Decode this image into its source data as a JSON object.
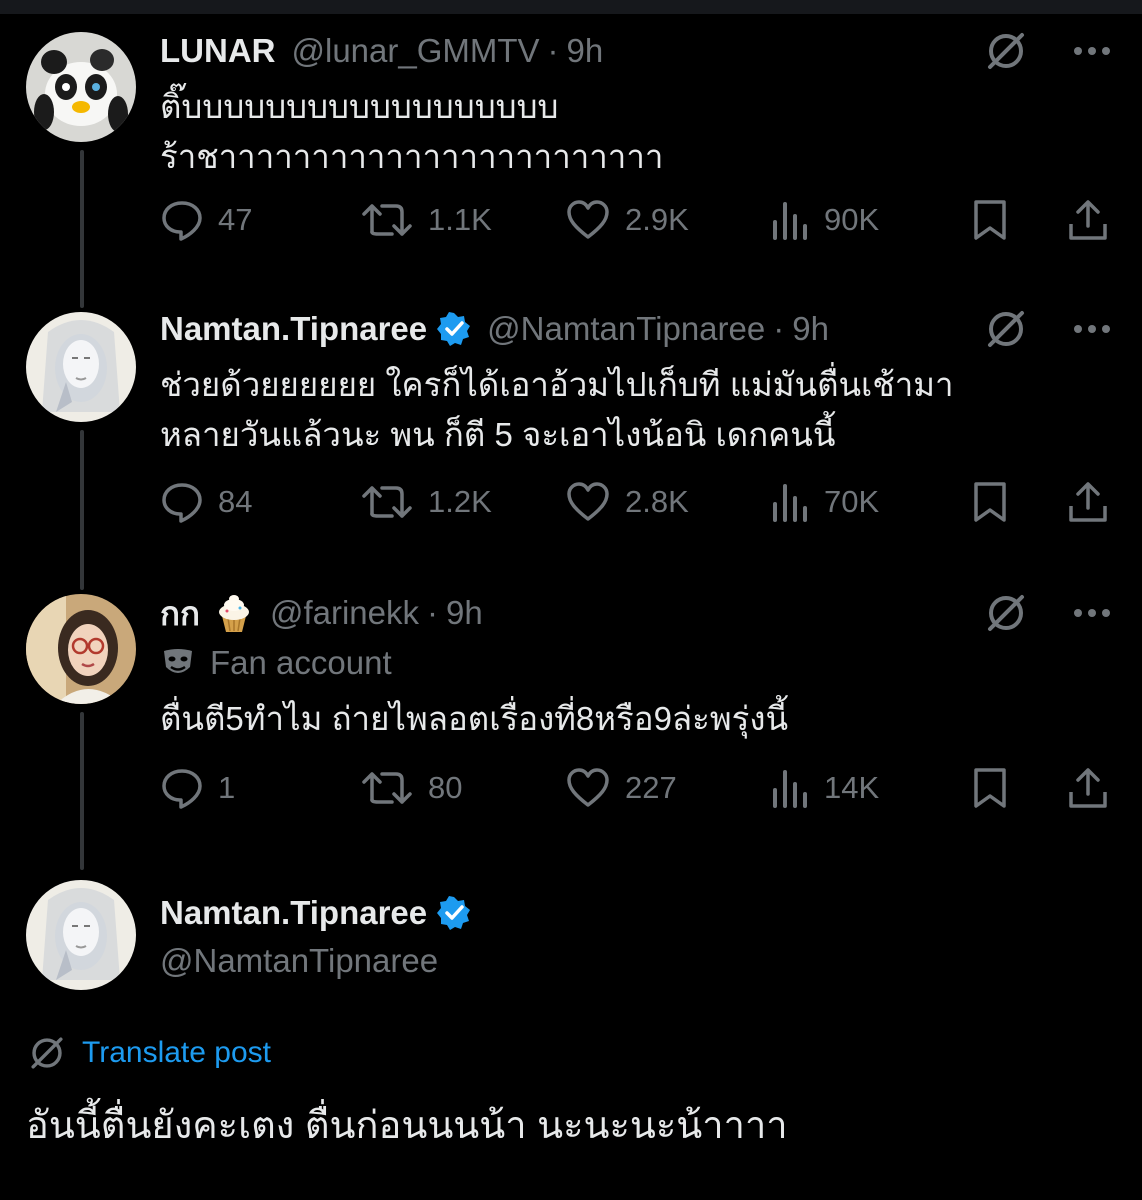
{
  "tweets": [
    {
      "name": "LUNAR",
      "handle": "@lunar_GMMTV",
      "time": "9h",
      "lines": [
        "ติ๊บบบบบบบบบบบบบบบบบบ",
        "ร้าชาาาาาาาาาาาาาาาาาาาาาาาา"
      ],
      "replies": "47",
      "reposts": "1.1K",
      "likes": "2.9K",
      "views": "90K"
    },
    {
      "name": "Namtan.Tipnaree",
      "handle": "@NamtanTipnaree",
      "time": "9h",
      "lines": [
        "ช่วยด้วยยยยยย ใครก็ได้เอาอ้วมไปเก็บที แม่มันตื่นเช้ามา",
        "หลายวันแล้วนะ พน ก็ตี 5 จะเอาไงน้อนิ เดกคนนี้"
      ],
      "replies": "84",
      "reposts": "1.2K",
      "likes": "2.8K",
      "views": "70K"
    },
    {
      "name": "กก",
      "handle": "@farinekk",
      "time": "9h",
      "label": "Fan account",
      "lines": [
        "ตื่นตี5ทำไม ถ่ายไพลอตเรื่องที่8หรือ9ล่ะพรุ่งนี้"
      ],
      "replies": "1",
      "reposts": "80",
      "likes": "227",
      "views": "14K"
    }
  ],
  "main_post": {
    "name": "Namtan.Tipnaree",
    "handle": "@NamtanTipnaree",
    "translate_label": "Translate post",
    "text": "อันนี้ตื่นยังคะเตง ตื่นก่อนนนน้า นะนะนะน้าาาา"
  },
  "colors": {
    "background": "#000000",
    "text": "#e7e9ea",
    "muted": "#71767b",
    "accent": "#1d9bf0"
  },
  "icons": [
    "grok-icon",
    "more-icon",
    "reply-icon",
    "repost-icon",
    "like-icon",
    "views-icon",
    "bookmark-icon",
    "share-icon",
    "verified-badge-icon",
    "cupcake-icon",
    "fan-mask-icon",
    "translate-icon"
  ]
}
